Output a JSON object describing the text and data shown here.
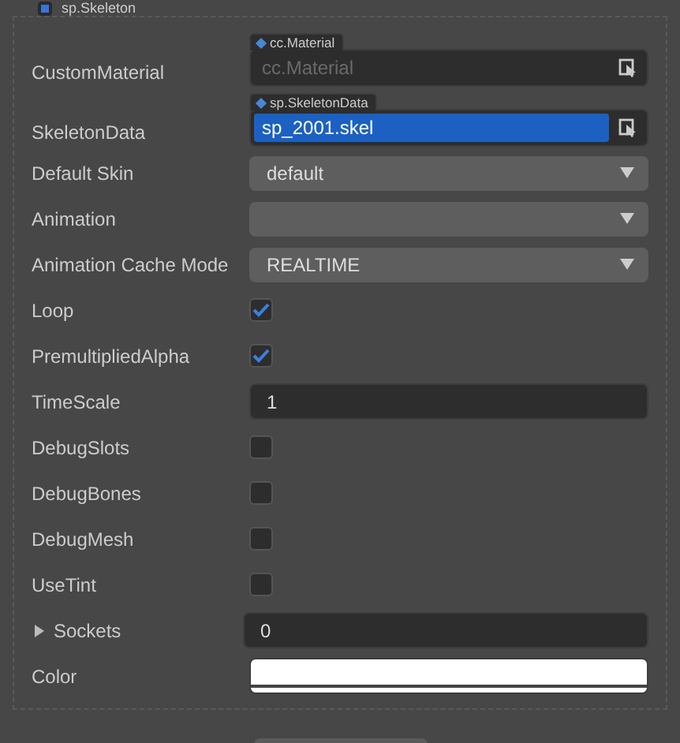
{
  "component": {
    "title": "sp.Skeleton",
    "enabled": true
  },
  "properties": [
    {
      "kind": "asset",
      "label": "CustomMaterial",
      "type_tag": "cc.Material",
      "placeholder": "cc.Material",
      "selected": false
    },
    {
      "kind": "asset",
      "label": "SkeletonData",
      "type_tag": "sp.SkeletonData",
      "value": "sp_2001.skel",
      "selected": true
    },
    {
      "kind": "select",
      "label": "Default Skin",
      "value": "default"
    },
    {
      "kind": "select",
      "label": "Animation"
    },
    {
      "kind": "select",
      "label": "Animation Cache Mode",
      "value": "REALTIME"
    },
    {
      "kind": "checkbox",
      "label": "Loop",
      "checked": true
    },
    {
      "kind": "checkbox",
      "label": "PremultipliedAlpha",
      "checked": true
    },
    {
      "kind": "number",
      "label": "TimeScale",
      "value": "1"
    },
    {
      "kind": "checkbox",
      "label": "DebugSlots",
      "checked": false
    },
    {
      "kind": "checkbox",
      "label": "DebugBones",
      "checked": false
    },
    {
      "kind": "checkbox",
      "label": "DebugMesh",
      "checked": false
    },
    {
      "kind": "checkbox",
      "label": "UseTint",
      "checked": false
    },
    {
      "kind": "group",
      "label": "Sockets",
      "value": "0",
      "expanded": false
    },
    {
      "kind": "color",
      "label": "Color",
      "color": "#ffffff"
    }
  ]
}
